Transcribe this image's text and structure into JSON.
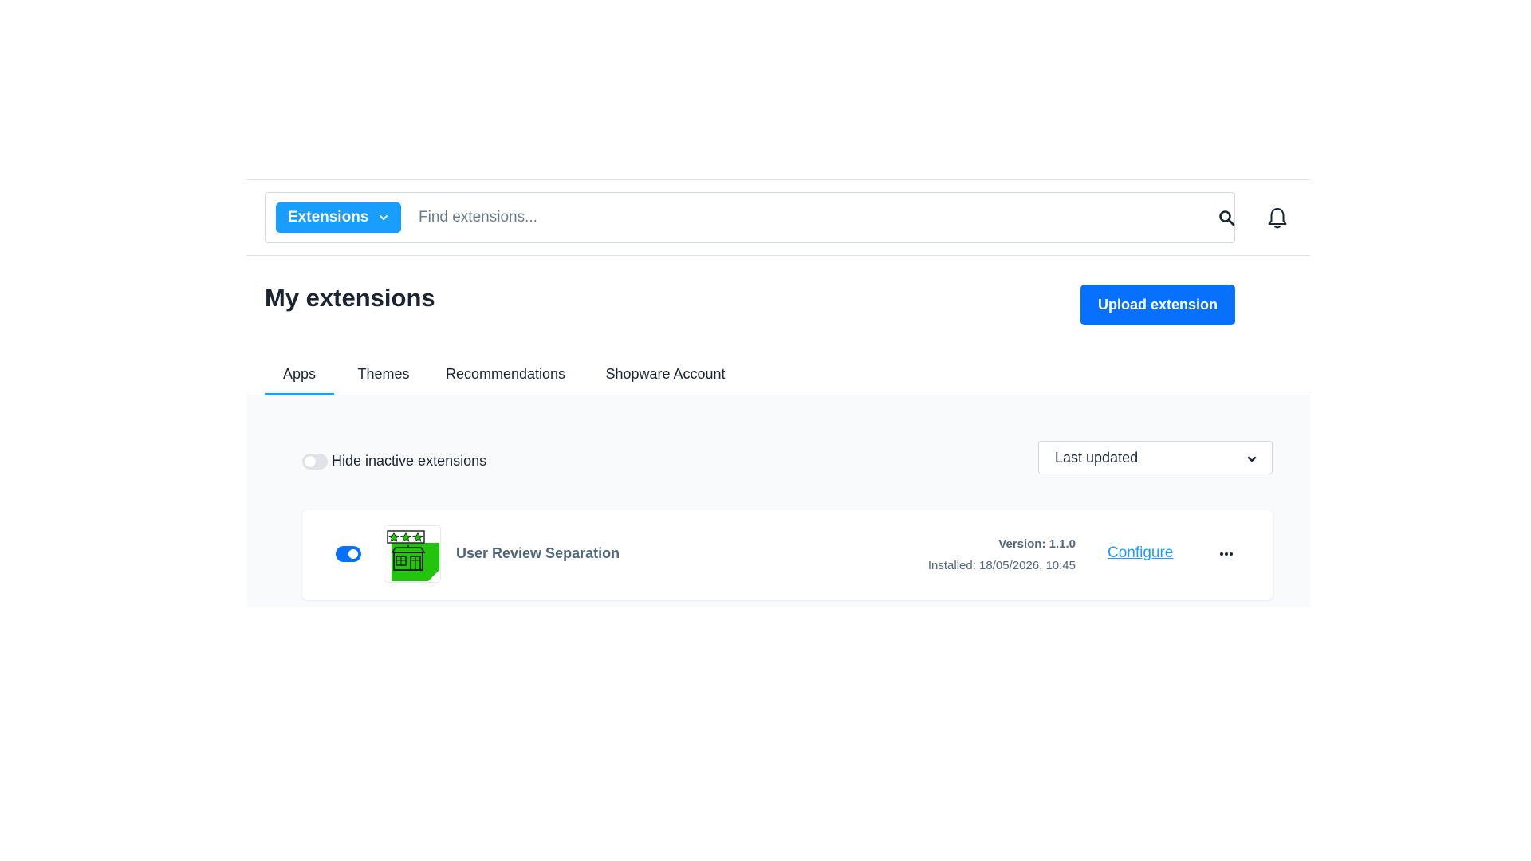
{
  "search": {
    "type_label": "Extensions",
    "placeholder": "Find extensions..."
  },
  "header": {
    "title": "My extensions",
    "upload_label": "Upload extension"
  },
  "tabs": [
    {
      "label": "Apps",
      "active": true
    },
    {
      "label": "Themes",
      "active": false
    },
    {
      "label": "Recommendations",
      "active": false
    },
    {
      "label": "Shopware Account",
      "active": false
    }
  ],
  "filters": {
    "hide_inactive_label": "Hide inactive extensions",
    "hide_inactive_on": false,
    "sort_selected": "Last updated"
  },
  "extension": {
    "name": "User Review Separation",
    "active": true,
    "version": "Version: 1.1.0",
    "installed": "Installed: 18/05/2026, 10:45",
    "configure_label": "Configure",
    "more_icon": "more-dots-icon",
    "logo_icon": "review-store-logo"
  },
  "icons": {
    "search": "search-icon",
    "bell": "bell-icon",
    "chevron": "chevron-down-icon"
  },
  "colors": {
    "primary": "#0870ff",
    "accent": "#189eff",
    "text": "#1a2433",
    "muted": "#52667a",
    "logo_green": "#22c40c"
  }
}
